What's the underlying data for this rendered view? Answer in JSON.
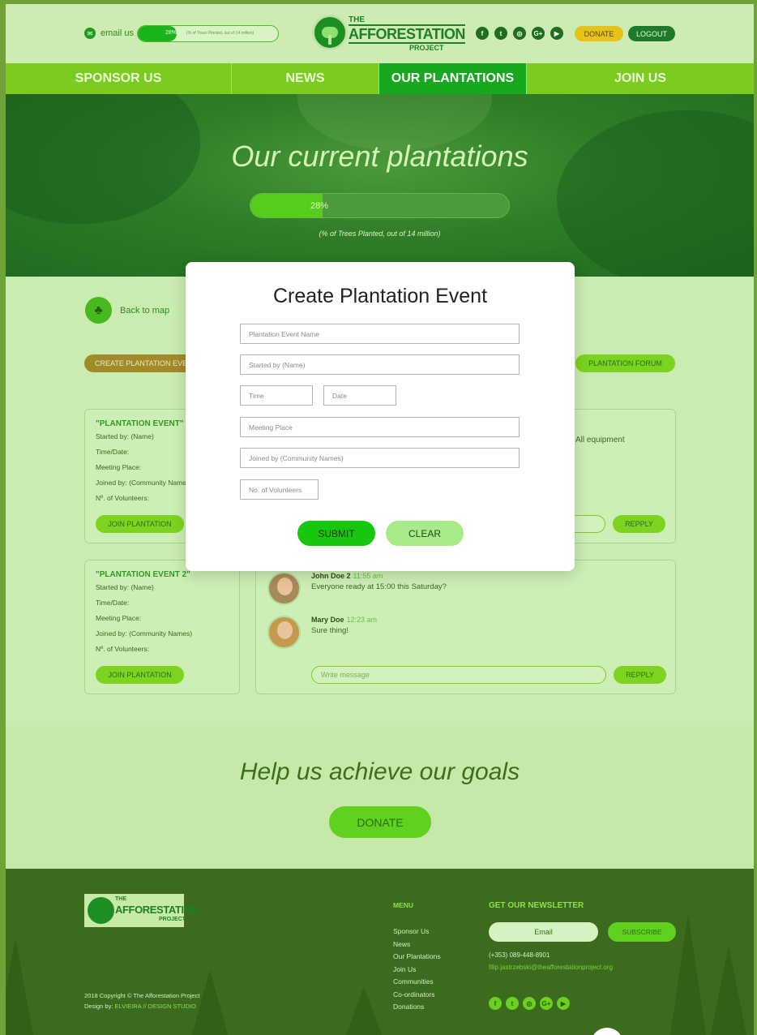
{
  "header": {
    "email_label": "email us",
    "progress": {
      "percent_label": "28%",
      "fraction": 0.28,
      "caption": "(% of Trees Planted, out of 14 million)"
    },
    "logo": {
      "the": "THE",
      "name": "AFFORESTATION",
      "project": "PROJECT"
    },
    "socials": [
      {
        "icon": "facebook-icon",
        "glyph": "f"
      },
      {
        "icon": "twitter-icon",
        "glyph": "t"
      },
      {
        "icon": "instagram-icon",
        "glyph": "◎"
      },
      {
        "icon": "google-plus-icon",
        "glyph": "G+"
      },
      {
        "icon": "youtube-icon",
        "glyph": "▶"
      }
    ],
    "donate_label": "DONATE",
    "logout_label": "LOGOUT"
  },
  "nav": {
    "items": [
      {
        "label": "SPONSOR US",
        "active": false
      },
      {
        "label": "NEWS",
        "active": false
      },
      {
        "label": "OUR PLANTATIONS",
        "active": true
      },
      {
        "label": "JOIN US",
        "active": false
      }
    ]
  },
  "hero": {
    "title": "Our current plantations",
    "progress_label": "28%",
    "progress_fraction": 0.28,
    "caption": "(% of Trees Planted, out of 14 million)"
  },
  "content": {
    "back_to_map": "Back to map",
    "create_button": "CREATE PLANTATION EVENT",
    "forum_button": "PLANTATION FORUM",
    "equipment_text": "All equipment",
    "events": [
      {
        "title": "\"PLANTATION EVENT\"",
        "rows": [
          "Started by: (Name)",
          "Time/Date:",
          "Meeting Place:",
          "Joined by: (Community Names)",
          "Nº. of Volunteers:"
        ],
        "join_label": "JOIN PLANTATION"
      },
      {
        "title": "\"PLANTATION EVENT 2\"",
        "rows": [
          "Started by: (Name)",
          "Time/Date:",
          "Meeting Place:",
          "Joined by: (Community Names)",
          "Nº. of Volunteers:"
        ],
        "join_label": "JOIN PLANTATION"
      }
    ],
    "chat": {
      "messages": [
        {
          "name": "John Doe 2",
          "time": "11:55 am",
          "text": "Everyone ready at 15:00 this Saturday?"
        },
        {
          "name": "Mary Doe",
          "time": "12:23 am",
          "text": "Sure thing!"
        }
      ],
      "write_placeholder": "Write message",
      "reply_label": "REPPLY"
    },
    "reply_label_1": "REPPLY"
  },
  "modal": {
    "title": "Create Plantation Event",
    "fields": {
      "event_name": "Plantation Event Name",
      "started_by": "Started by (Name)",
      "time": "Time",
      "date": "Date",
      "meeting_place": "Meeting Place",
      "joined_by": "Joined by (Community Names)",
      "volunteers": "No. of Volunteers"
    },
    "submit_label": "SUBMIT",
    "clear_label": "CLEAR"
  },
  "goals": {
    "title": "Help us achieve our goals",
    "donate_label": "DONATE"
  },
  "footer": {
    "logo": {
      "the": "THE",
      "name": "AFFORESTATION",
      "project": "PROJECT"
    },
    "copyright": "2018 Copyright © The Afforestation Project",
    "design_by_prefix": "Design by:",
    "design_by_name": "ELVIEIRA // DESIGN STUDIO",
    "menu_title": "MENU",
    "menu_items": [
      "Sponsor Us",
      "News",
      "Our Plantations",
      "Join Us",
      "Communities",
      "Co-ordinators",
      "Donations"
    ],
    "newsletter_title": "GET OUR NEWSLETTER",
    "email_placeholder": "Email",
    "subscribe_label": "SUBSCRIBE",
    "phone": "(+353) 089-448-8901",
    "contact_email": "filip.jastrzebski@theafforestationproject.org"
  },
  "colors": {
    "brand_green": "#1e7f24",
    "nav_green": "#7ccc1f",
    "active_tab": "#18a81f",
    "donate_yellow": "#e6c21a",
    "submit_green": "#17c60f"
  }
}
